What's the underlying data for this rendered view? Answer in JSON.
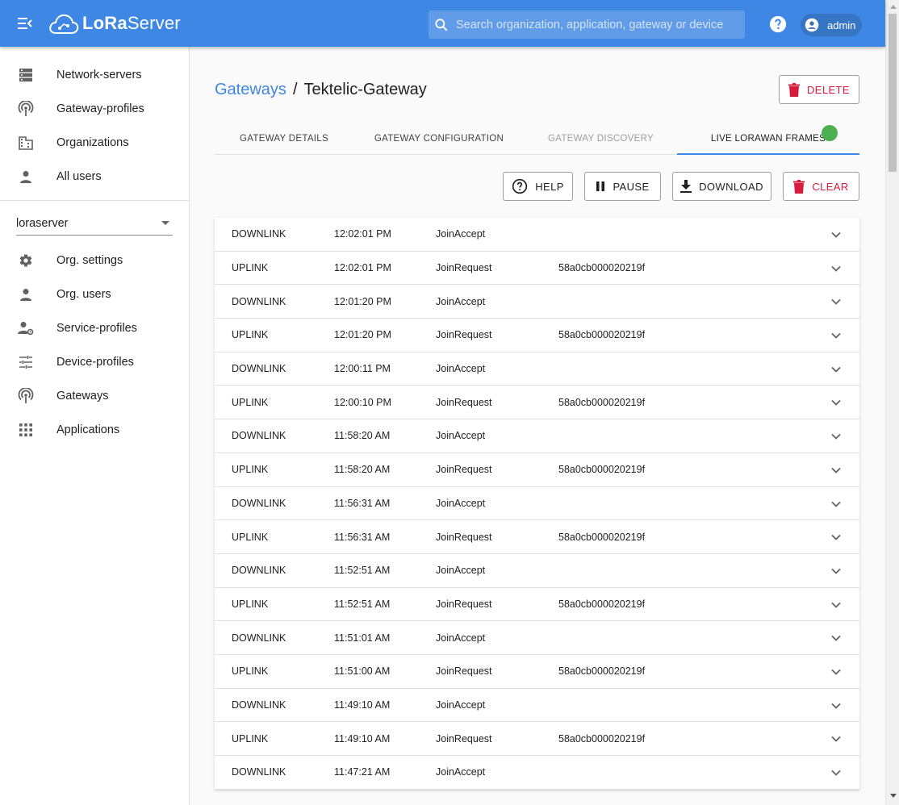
{
  "header": {
    "logo_brand_bold": "LoRa",
    "logo_brand_light": "Server",
    "search_placeholder": "Search organization, application, gateway or device",
    "user_name": "admin"
  },
  "sidebar": {
    "top_items": [
      {
        "label": "Network-servers",
        "icon": "server-icon"
      },
      {
        "label": "Gateway-profiles",
        "icon": "antenna-icon"
      },
      {
        "label": "Organizations",
        "icon": "building-icon"
      },
      {
        "label": "All users",
        "icon": "person-icon"
      }
    ],
    "org_selected": "loraserver",
    "org_items": [
      {
        "label": "Org. settings",
        "icon": "gear-icon"
      },
      {
        "label": "Org. users",
        "icon": "person-icon"
      },
      {
        "label": "Service-profiles",
        "icon": "account-settings-icon"
      },
      {
        "label": "Device-profiles",
        "icon": "tune-icon"
      },
      {
        "label": "Gateways",
        "icon": "antenna-icon"
      },
      {
        "label": "Applications",
        "icon": "apps-grid-icon"
      }
    ]
  },
  "main": {
    "breadcrumb_root": "Gateways",
    "breadcrumb_separator": "/",
    "breadcrumb_current": "Tektelic-Gateway",
    "delete_label": "DELETE",
    "tabs": [
      {
        "label": "GATEWAY DETAILS",
        "state": "normal"
      },
      {
        "label": "GATEWAY CONFIGURATION",
        "state": "normal"
      },
      {
        "label": "GATEWAY DISCOVERY",
        "state": "disabled"
      },
      {
        "label": "LIVE LORAWAN FRAMES",
        "state": "active"
      }
    ],
    "live_status_color": "#4caf50",
    "actions": {
      "help_label": "HELP",
      "pause_label": "PAUSE",
      "download_label": "DOWNLOAD",
      "clear_label": "CLEAR"
    },
    "frames": [
      {
        "direction": "DOWNLINK",
        "time": "12:02:01 PM",
        "type": "JoinAccept",
        "device": ""
      },
      {
        "direction": "UPLINK",
        "time": "12:02:01 PM",
        "type": "JoinRequest",
        "device": "58a0cb000020219f"
      },
      {
        "direction": "DOWNLINK",
        "time": "12:01:20 PM",
        "type": "JoinAccept",
        "device": ""
      },
      {
        "direction": "UPLINK",
        "time": "12:01:20 PM",
        "type": "JoinRequest",
        "device": "58a0cb000020219f"
      },
      {
        "direction": "DOWNLINK",
        "time": "12:00:11 PM",
        "type": "JoinAccept",
        "device": ""
      },
      {
        "direction": "UPLINK",
        "time": "12:00:10 PM",
        "type": "JoinRequest",
        "device": "58a0cb000020219f"
      },
      {
        "direction": "DOWNLINK",
        "time": "11:58:20 AM",
        "type": "JoinAccept",
        "device": ""
      },
      {
        "direction": "UPLINK",
        "time": "11:58:20 AM",
        "type": "JoinRequest",
        "device": "58a0cb000020219f"
      },
      {
        "direction": "DOWNLINK",
        "time": "11:56:31 AM",
        "type": "JoinAccept",
        "device": ""
      },
      {
        "direction": "UPLINK",
        "time": "11:56:31 AM",
        "type": "JoinRequest",
        "device": "58a0cb000020219f"
      },
      {
        "direction": "DOWNLINK",
        "time": "11:52:51 AM",
        "type": "JoinAccept",
        "device": ""
      },
      {
        "direction": "UPLINK",
        "time": "11:52:51 AM",
        "type": "JoinRequest",
        "device": "58a0cb000020219f"
      },
      {
        "direction": "DOWNLINK",
        "time": "11:51:01 AM",
        "type": "JoinAccept",
        "device": ""
      },
      {
        "direction": "UPLINK",
        "time": "11:51:00 AM",
        "type": "JoinRequest",
        "device": "58a0cb000020219f"
      },
      {
        "direction": "DOWNLINK",
        "time": "11:49:10 AM",
        "type": "JoinAccept",
        "device": ""
      },
      {
        "direction": "UPLINK",
        "time": "11:49:10 AM",
        "type": "JoinRequest",
        "device": "58a0cb000020219f"
      },
      {
        "direction": "DOWNLINK",
        "time": "11:47:21 AM",
        "type": "JoinAccept",
        "device": ""
      }
    ]
  },
  "colors": {
    "appbar": "#3f87e5",
    "link": "#3f87e5",
    "danger": "#d81b3c"
  }
}
